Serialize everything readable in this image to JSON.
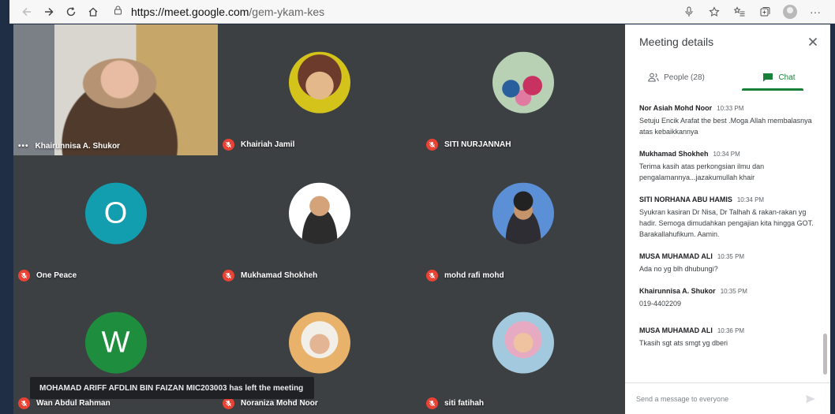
{
  "browser": {
    "url_host": "https://meet.google.com",
    "url_path": "/gem-ykam-kes",
    "more_label": "···"
  },
  "tiles": [
    {
      "name": "Khairunnisa A. Shukor",
      "kind": "camera"
    },
    {
      "name": "Khairiah Jamil",
      "kind": "photo"
    },
    {
      "name": "SITI NURJANNAH",
      "kind": "photo"
    },
    {
      "name": "One Peace",
      "kind": "letter",
      "letter": "O",
      "color": "#129eaf"
    },
    {
      "name": "Mukhamad Shokheh",
      "kind": "photo"
    },
    {
      "name": "mohd rafi mohd",
      "kind": "photo"
    },
    {
      "name": "Wan Abdul Rahman",
      "kind": "letter",
      "letter": "W",
      "color": "#1e8e3e"
    },
    {
      "name": "Noraniza Mohd Noor",
      "kind": "photo"
    },
    {
      "name": "siti fatihah",
      "kind": "photo"
    }
  ],
  "toast": "MOHAMAD ARIFF AFDLIN BIN FAIZAN MIC203003 has left the meeting",
  "panel": {
    "title": "Meeting details",
    "tab_people": "People (28)",
    "tab_chat": "Chat",
    "messages": [
      {
        "author": "Nor Asiah Mohd Noor",
        "time": "10:33 PM",
        "text": "Setuju Encik Arafat the best .Moga Allah membalasnya atas kebaikkannya"
      },
      {
        "author": "Mukhamad Shokheh",
        "time": "10:34 PM",
        "text": "Terima kasih atas perkongsian ilmu dan pengalamannya...jazakumullah khair"
      },
      {
        "author": "SITI NORHANA ABU HAMIS",
        "time": "10:34 PM",
        "text": "Syukran kasiran Dr Nisa, Dr Talhah & rakan-rakan yg hadir. Semoga dimudahkan pengajian kita hingga GOT. Barakallahufikum. Aamin."
      },
      {
        "author": "MUSA MUHAMAD ALI",
        "time": "10:35 PM",
        "text": "Ada no yg blh dhubungi?"
      },
      {
        "author": "Khairunnisa A. Shukor",
        "time": "10:35 PM",
        "text": "019-4402209"
      },
      {
        "author": "MUSA MUHAMAD ALI",
        "time": "10:36 PM",
        "text": "Tkasih sgt ats smgt yg dberi"
      }
    ],
    "send_placeholder": "Send a message to everyone"
  },
  "colors": {
    "accent": "#188038",
    "mic_off": "#ea4335",
    "tile_bg": "#3c4043"
  }
}
